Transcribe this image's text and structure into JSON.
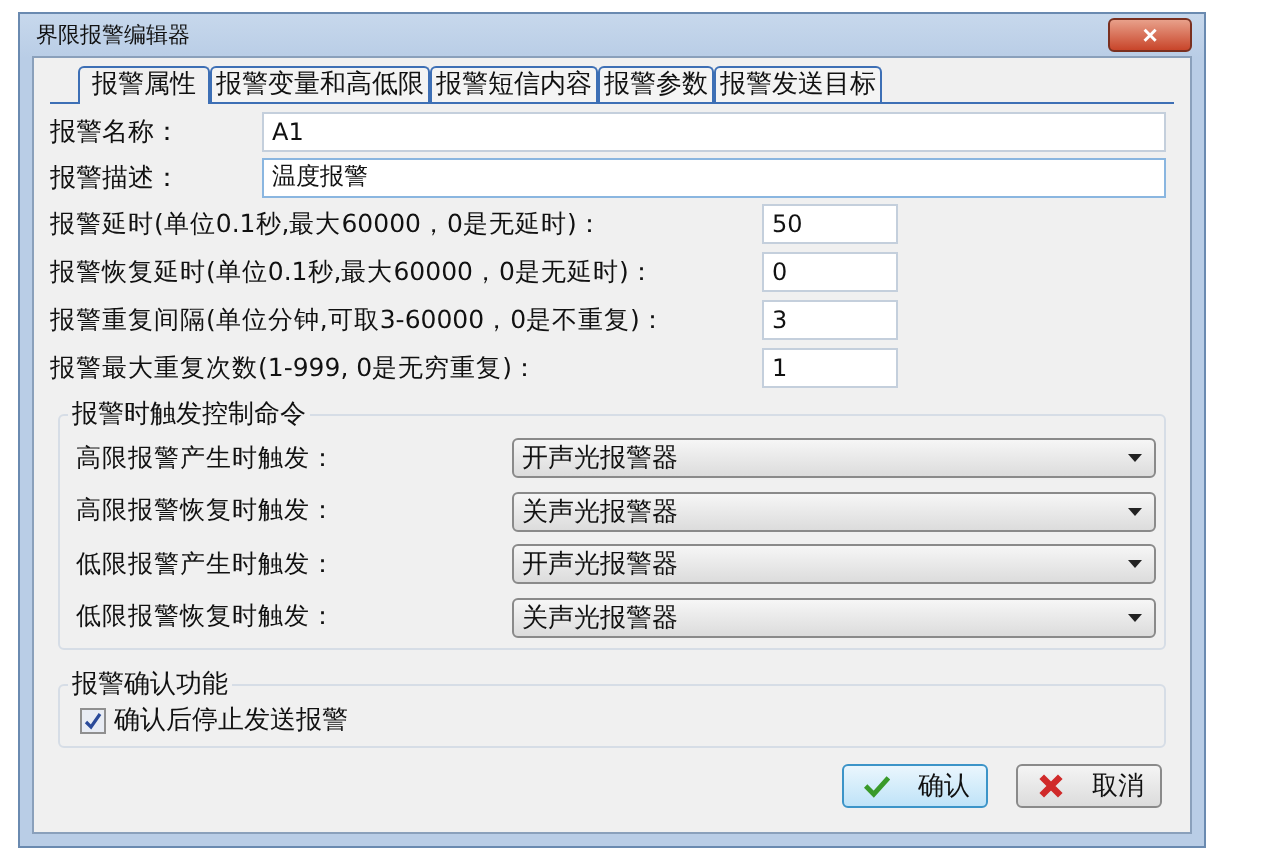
{
  "window": {
    "title": "界限报警编辑器",
    "close": "×"
  },
  "tabs": [
    {
      "label": "报警属性",
      "selected": true
    },
    {
      "label": "报警变量和高低限",
      "selected": false
    },
    {
      "label": "报警短信内容",
      "selected": false
    },
    {
      "label": "报警参数",
      "selected": false
    },
    {
      "label": "报警发送目标",
      "selected": false
    }
  ],
  "text_fields": [
    {
      "label": "报警名称：",
      "value": "A1"
    },
    {
      "label": "报警描述：",
      "value": "温度报警"
    }
  ],
  "number_fields": [
    {
      "label": "报警延时(单位0.1秒,最大60000，0是无延时)：",
      "value": "50"
    },
    {
      "label": "报警恢复延时(单位0.1秒,最大60000，0是无延时)：",
      "value": "0"
    },
    {
      "label": "报警重复间隔(单位分钟,可取3-60000，0是不重复)：",
      "value": "3"
    },
    {
      "label": "报警最大重复次数(1-999, 0是无穷重复)：",
      "value": "1"
    }
  ],
  "trigger_group": {
    "title": "报警时触发控制命令",
    "rows": [
      {
        "label": "高限报警产生时触发：",
        "value": "开声光报警器"
      },
      {
        "label": "高限报警恢复时触发：",
        "value": "关声光报警器"
      },
      {
        "label": "低限报警产生时触发：",
        "value": "开声光报警器"
      },
      {
        "label": "低限报警恢复时触发：",
        "value": "关声光报警器"
      }
    ]
  },
  "confirm_group": {
    "title": "报警确认功能",
    "checkbox": {
      "label": "确认后停止发送报警",
      "checked": true
    }
  },
  "buttons": [
    {
      "label": "确认",
      "kind": "ok"
    },
    {
      "label": "取消",
      "kind": "cancel"
    }
  ]
}
